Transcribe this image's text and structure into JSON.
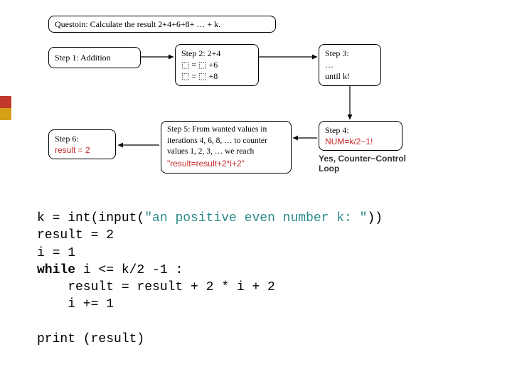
{
  "question": "Questoin: Calculate the result 2+4+6+8+ … + k.",
  "steps": {
    "s1": {
      "title": "Step 1: Addition"
    },
    "s2": {
      "title": "Step 2: 2+4",
      "l2": "⬚ = ⬚ +6",
      "l3": "⬚ = ⬚ +8"
    },
    "s3": {
      "title": "Step 3:",
      "l2": "…",
      "l3": "until k!"
    },
    "s4": {
      "title": "Step 4:",
      "formula": "NUM=k/2−1!",
      "caption": "Yes, Counter−Control Loop"
    },
    "s5": {
      "title": "Step 5: From wanted values in iterations 4, 6, 8, … to counter values 1, 2, 3, … we reach ",
      "expr": "\"result=result+2*i+2\""
    },
    "s6": {
      "title": "Step 6:",
      "l2": "result = 2"
    }
  },
  "code": {
    "l1a": "k = int(input(",
    "l1b": "\"an positive even number k: \"",
    "l1c": "))",
    "l2": "result = 2",
    "l3": "i = 1",
    "l4a": "while",
    "l4b": " i <= k/2 -1 :",
    "l5": "    result = result + 2 * i + 2",
    "l6": "    i += 1",
    "l7": "",
    "l8": "print (result)"
  }
}
